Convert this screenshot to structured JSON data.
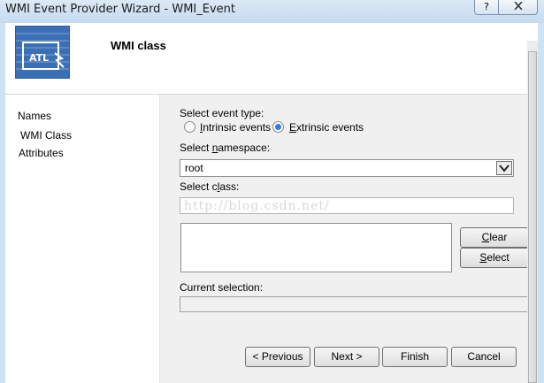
{
  "window": {
    "title": "WMI Event Provider Wizard - WMI_Event",
    "help_label": "?",
    "close_label": "X"
  },
  "header": {
    "title": "WMI class",
    "logo_text": "ATL"
  },
  "nav": {
    "items": [
      {
        "label": "Names"
      },
      {
        "label": "WMI Class"
      },
      {
        "label": "Attributes"
      }
    ]
  },
  "form": {
    "event_type_label": "Select event type:",
    "intrinsic_pre": "",
    "intrinsic_key": "I",
    "intrinsic_post": "ntrinsic events",
    "extrinsic_pre": "",
    "extrinsic_key": "E",
    "extrinsic_post": "xtrinsic events",
    "selected_event_type": "extrinsic",
    "namespace_label_pre": "Select ",
    "namespace_label_key": "n",
    "namespace_label_post": "amespace:",
    "namespace_value": "root",
    "class_label_pre": "Select c",
    "class_label_key": "l",
    "class_label_post": "ass:",
    "class_value": "",
    "watermark": "http://blog.csdn.net/",
    "clear_key": "C",
    "clear_post": "lear",
    "select_key": "S",
    "select_post": "elect",
    "current_selection_label": "Current selection:",
    "current_selection_value": ""
  },
  "footer": {
    "previous_label": "< Previous",
    "next_label": "Next >",
    "finish_label": "Finish",
    "cancel_label": "Cancel"
  }
}
